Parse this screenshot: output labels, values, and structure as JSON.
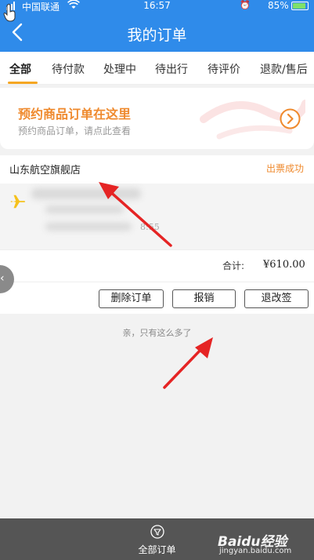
{
  "status_bar": {
    "carrier": "中国联通",
    "time": "16:57",
    "battery": "85%"
  },
  "header": {
    "title": "我的订单"
  },
  "tabs": [
    {
      "label": "全部",
      "active": true
    },
    {
      "label": "待付款"
    },
    {
      "label": "处理中"
    },
    {
      "label": "待出行"
    },
    {
      "label": "待评价"
    },
    {
      "label": "退款/售后"
    }
  ],
  "promo": {
    "title": "预约商品订单在这里",
    "subtitle": "预约商品订单，请点此查看"
  },
  "order": {
    "shop": "山东航空旗舰店",
    "status": "出票成功",
    "flight_time": "8:55",
    "total_label": "合计:",
    "total_value": "¥610.00",
    "buttons": {
      "delete": "删除订单",
      "reimburse": "报销",
      "change": "退改签"
    }
  },
  "end_text": "亲，只有这么多了",
  "bottom_nav": {
    "all_orders": "全部订单"
  },
  "watermark": {
    "brand": "Baidu经验",
    "url": "jingyan.baidu.com"
  },
  "colors": {
    "header": "#2f8bea",
    "accent": "#ef8a2e",
    "tab_underline": "#f5a623",
    "arrow": "#e52424"
  }
}
